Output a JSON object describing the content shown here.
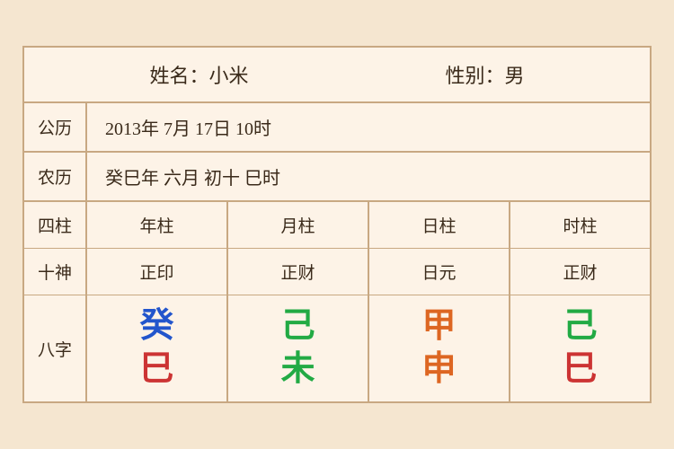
{
  "header": {
    "name_label": "姓名：小米",
    "gender_label": "性别：男"
  },
  "solar": {
    "label": "公历",
    "value": "2013年 7月 17日 10时"
  },
  "lunar": {
    "label": "农历",
    "value": "癸巳年 六月 初十 巳时"
  },
  "pillars": {
    "label": "四柱",
    "columns": [
      "年柱",
      "月柱",
      "日柱",
      "时柱"
    ]
  },
  "shishen": {
    "label": "十神",
    "columns": [
      "正印",
      "正财",
      "日元",
      "正财"
    ]
  },
  "bazi": {
    "label": "八字",
    "columns": [
      {
        "top": "癸",
        "bottom": "巳",
        "top_color": "blue",
        "bottom_color": "red"
      },
      {
        "top": "己",
        "bottom": "未",
        "top_color": "green",
        "bottom_color": "green"
      },
      {
        "top": "甲",
        "bottom": "申",
        "top_color": "orange",
        "bottom_color": "orange"
      },
      {
        "top": "己",
        "bottom": "巳",
        "top_color": "green",
        "bottom_color": "red"
      }
    ]
  }
}
